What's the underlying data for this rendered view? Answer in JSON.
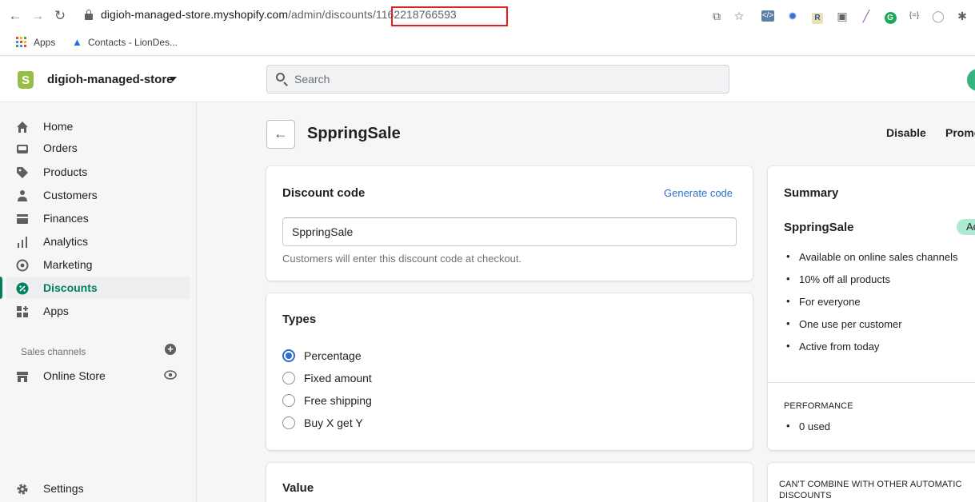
{
  "browser": {
    "url_host": "digioh-managed-store.myshopify.com",
    "url_path": "/admin/discounts/",
    "url_id": "1162218766593",
    "bookmarks": [
      "Apps",
      "Contacts - LionDes..."
    ]
  },
  "topbar": {
    "store_name": "digioh-managed-store",
    "search_placeholder": "Search"
  },
  "sidebar": {
    "items": [
      {
        "label": "Home"
      },
      {
        "label": "Orders"
      },
      {
        "label": "Products"
      },
      {
        "label": "Customers"
      },
      {
        "label": "Finances"
      },
      {
        "label": "Analytics"
      },
      {
        "label": "Marketing"
      },
      {
        "label": "Discounts"
      },
      {
        "label": "Apps"
      }
    ],
    "sales_channels_title": "Sales channels",
    "online_store": "Online Store",
    "settings": "Settings"
  },
  "page": {
    "title": "SppringSale",
    "actions": {
      "disable": "Disable",
      "promote": "Promo"
    }
  },
  "discount_code": {
    "title": "Discount code",
    "generate": "Generate code",
    "value": "SppringSale",
    "help": "Customers will enter this discount code at checkout."
  },
  "types": {
    "title": "Types",
    "options": [
      "Percentage",
      "Fixed amount",
      "Free shipping",
      "Buy X get Y"
    ],
    "selected": "Percentage"
  },
  "value_card": {
    "title": "Value"
  },
  "summary": {
    "title": "Summary",
    "code": "SppringSale",
    "status": "Ac",
    "details": [
      "Available on online sales channels",
      "10% off all products",
      "For everyone",
      "One use per customer",
      "Active from today"
    ],
    "performance_title": "PERFORMANCE",
    "performance": [
      "0 used"
    ],
    "combine_title": "CAN'T COMBINE WITH OTHER AUTOMATIC DISCOUNTS"
  },
  "colors": {
    "accent": "#008060",
    "link": "#2c6ecb",
    "badge": "#aee9d1",
    "highlight": "#e02020"
  }
}
